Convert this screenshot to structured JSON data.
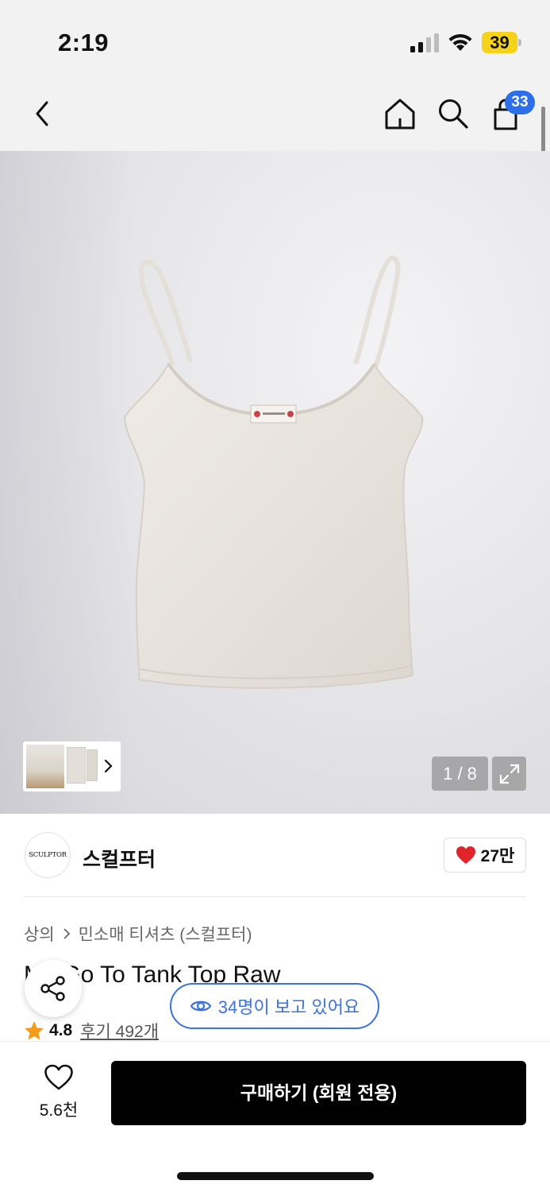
{
  "status": {
    "time": "2:19",
    "battery": "39"
  },
  "nav": {
    "cart_badge": "33"
  },
  "gallery": {
    "counter": "1 / 8"
  },
  "brand": {
    "name": "스컬프터",
    "logo_text": "SCULPTOR",
    "likes": "27만"
  },
  "breadcrumb": {
    "category": "상의",
    "subcategory": "민소매 티셔츠 (스컬프터)"
  },
  "product": {
    "title": "My Go To Tank Top Raw",
    "rating": "4.8",
    "reviews": "후기 492개"
  },
  "viewers": {
    "text": "34명이 보고 있어요"
  },
  "bottom": {
    "wish_count": "5.6천",
    "buy_label": "구매하기 (회원 전용)"
  },
  "colors": {
    "accent": "#3b73d9",
    "badge": "#2c6fe8",
    "heart": "#e0242b",
    "star": "#f59b1c",
    "battery": "#f7d21b"
  },
  "icons": [
    "back-icon",
    "home-icon",
    "search-icon",
    "cart-icon",
    "chevron-right-icon",
    "expand-icon",
    "heart-icon",
    "share-icon",
    "eye-icon",
    "star-icon"
  ]
}
